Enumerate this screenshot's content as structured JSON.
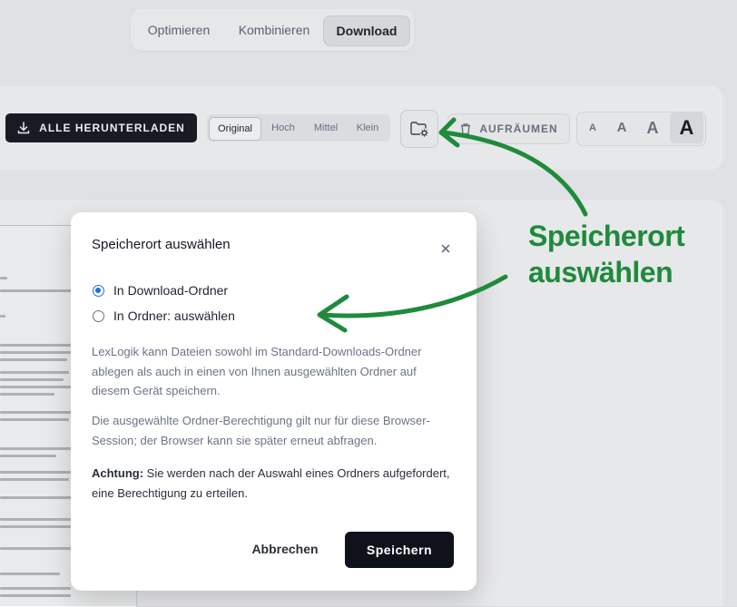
{
  "tabs": [
    {
      "label": "Optimieren",
      "active": false
    },
    {
      "label": "Kombinieren",
      "active": false
    },
    {
      "label": "Download",
      "active": true
    }
  ],
  "toolbar": {
    "download_all_label": "ALLE HERUNTERLADEN",
    "quality_options": [
      "Original",
      "Hoch",
      "Mittel",
      "Klein"
    ],
    "quality_selected": "Original",
    "folder_button_icon": "folder-settings-icon",
    "cleanup_label": "AUFRÄUMEN",
    "font_sizes": [
      "A",
      "A",
      "A",
      "A"
    ],
    "font_size_selected_index": 3
  },
  "modal": {
    "title": "Speicherort auswählen",
    "close_icon": "close-icon",
    "options": [
      {
        "label": "In Download-Ordner",
        "checked": true
      },
      {
        "label": "In Ordner: auswählen",
        "checked": false
      }
    ],
    "description_1": "LexLogik kann Dateien sowohl im Standard-Downloads-Ordner ablegen als auch in einen von Ihnen ausgewählten Ordner auf diesem Gerät speichern.",
    "description_2": "Die ausgewählte Ordner-Berechtigung gilt nur für diese Browser-Session; der Browser kann sie später erneut abfragen.",
    "warning_label": "Achtung:",
    "warning_text": " Sie werden nach der Auswahl eines Ordners aufgefordert, eine Berechtigung zu erteilen.",
    "cancel_label": "Abbrechen",
    "save_label": "Speichern"
  },
  "annotation": {
    "line1": "Speicherort",
    "line2": "auswählen",
    "color": "#1f8a3c"
  }
}
